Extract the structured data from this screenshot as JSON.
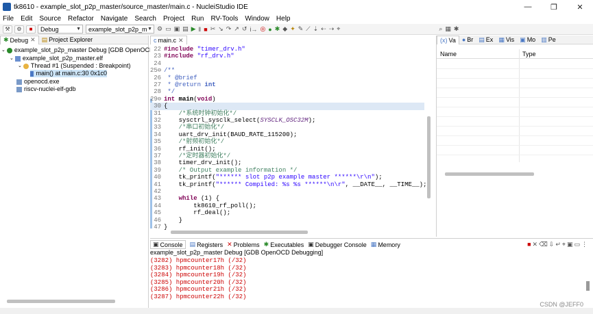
{
  "window": {
    "title": "tk8610 - example_slot_p2p_master/source_master/main.c - NucleiStudio IDE",
    "controls": [
      "—",
      "❐",
      "✕"
    ]
  },
  "menu": [
    "File",
    "Edit",
    "Source",
    "Refactor",
    "Navigate",
    "Search",
    "Project",
    "Run",
    "RV-Tools",
    "Window",
    "Help"
  ],
  "toolbar": {
    "mode": "Debug",
    "launch_config": "example_slot_p2p_m"
  },
  "debug_panel": {
    "tabs": [
      "Debug",
      "Project Explorer"
    ],
    "tree": [
      {
        "label": "example_slot_p2p_master Debug [GDB OpenOCD",
        "icon": "debug-launch-icon"
      },
      {
        "label": "example_slot_p2p_master.elf",
        "icon": "elf-icon"
      },
      {
        "label": "Thread #1 (Suspended : Breakpoint)",
        "icon": "thread-icon"
      },
      {
        "label": "main() at main.c:30 0x1c0",
        "icon": "stack-frame-icon"
      },
      {
        "label": "openocd.exe",
        "icon": "process-icon"
      },
      {
        "label": "riscv-nuclei-elf-gdb",
        "icon": "process-icon"
      }
    ]
  },
  "editor": {
    "tab": "main.c"
  },
  "vars_panel": {
    "tabs": [
      "Va",
      "Br",
      "Ex",
      "Vis",
      "Mo",
      "Pe"
    ],
    "col_name": "Name",
    "col_type": "Type"
  },
  "console": {
    "tabs": [
      "Console",
      "Registers",
      "Problems",
      "Executables",
      "Debugger Console",
      "Memory"
    ],
    "header": "example_slot_p2p_master Debug [GDB OpenOCD Debugging]",
    "lines": [
      "(3282) hpmcounter17h (/32)",
      "(3283) hpmcounter18h (/32)",
      "(3284) hpmcounter19h (/32)",
      "(3285) hpmcounter20h (/32)",
      "(3286) hpmcounter21h (/32)",
      "(3287) hpmcounter22h (/32)"
    ]
  },
  "watermark": "CSDN @JEFF0"
}
